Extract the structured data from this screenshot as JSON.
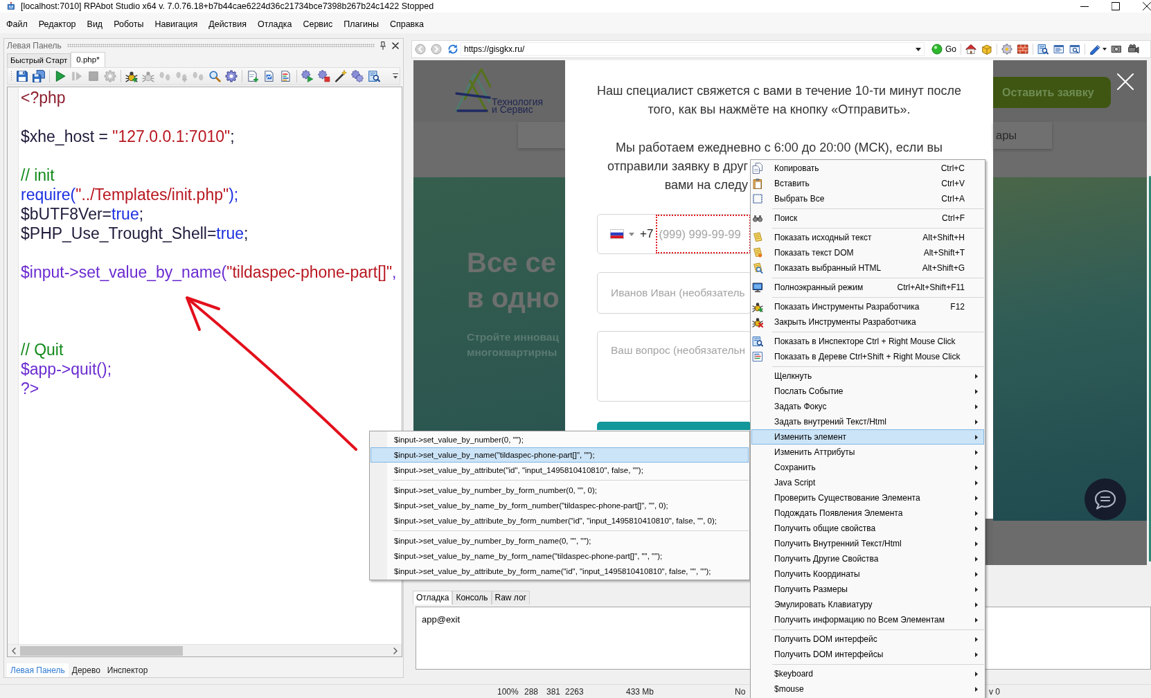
{
  "window": {
    "title": "[localhost:7010] RPAbot Studio x64 v. 7.0.76.18+b7b44cae6224d36c21734bce7398b267b24c1422 Stopped"
  },
  "menu_bar": [
    "Файл",
    "Редактор",
    "Вид",
    "Роботы",
    "Навигация",
    "Действия",
    "Отладка",
    "Сервис",
    "Плагины",
    "Справка"
  ],
  "left_panel": {
    "title": "Левая Панель",
    "tabs": [
      {
        "label": "Быстрый Старт",
        "selected": false
      },
      {
        "label": "0.php*",
        "selected": true
      }
    ],
    "toolbar": [
      [
        {
          "disabled": false
        },
        {
          "disabled": false
        }
      ],
      [
        {
          "disabled": false
        },
        {
          "disabled": true
        },
        {
          "disabled": true
        },
        {
          "disabled": true
        }
      ],
      [
        {
          "disabled": false
        },
        {
          "disabled": true
        },
        {
          "disabled": true
        },
        {
          "disabled": true
        },
        {
          "disabled": true
        },
        {
          "disabled": false
        },
        {
          "disabled": false
        }
      ],
      [
        {
          "disabled": false
        },
        {
          "disabled": false
        },
        {
          "disabled": false
        }
      ],
      [
        {
          "disabled": false
        },
        {
          "disabled": false
        },
        {
          "disabled": false
        },
        {
          "disabled": false
        },
        {
          "disabled": false
        }
      ]
    ],
    "code": [
      {
        "kind": "code",
        "tokens": [
          {
            "kind": "tag_open",
            "text": "<?php"
          }
        ]
      },
      {
        "kind": "blank"
      },
      {
        "kind": "code",
        "tokens": [
          {
            "kind": "var",
            "text": "$xhe_host"
          },
          {
            "kind": "op",
            "text": " = "
          },
          {
            "kind": "string",
            "text": "\"127.0.0.1:7010\""
          },
          {
            "kind": "op",
            "text": ";"
          }
        ]
      },
      {
        "kind": "blank"
      },
      {
        "kind": "code",
        "tokens": [
          {
            "kind": "comment",
            "text": "// init"
          }
        ]
      },
      {
        "kind": "code",
        "tokens": [
          {
            "kind": "func",
            "text": "require("
          },
          {
            "kind": "string",
            "text": "\"../Templates/init.php\""
          },
          {
            "kind": "func",
            "text": ");"
          }
        ]
      },
      {
        "kind": "code",
        "tokens": [
          {
            "kind": "var",
            "text": "$bUTF8Ver"
          },
          {
            "kind": "op",
            "text": "="
          },
          {
            "kind": "keyword",
            "text": "true"
          },
          {
            "kind": "op",
            "text": ";"
          }
        ]
      },
      {
        "kind": "code",
        "tokens": [
          {
            "kind": "var",
            "text": "$PHP_Use_Trought_Shell"
          },
          {
            "kind": "op",
            "text": "="
          },
          {
            "kind": "keyword",
            "text": "true"
          },
          {
            "kind": "op",
            "text": ";"
          }
        ]
      },
      {
        "kind": "blank"
      },
      {
        "kind": "code",
        "tokens": [
          {
            "kind": "call",
            "text": "$input->set_value_by_name("
          },
          {
            "kind": "string",
            "text": "\"tildaspec-phone-part[]\""
          },
          {
            "kind": "call",
            "text": ","
          }
        ]
      },
      {
        "kind": "blank"
      },
      {
        "kind": "blank"
      },
      {
        "kind": "blank"
      },
      {
        "kind": "code",
        "tokens": [
          {
            "kind": "comment",
            "text": "// Quit"
          }
        ]
      },
      {
        "kind": "code",
        "tokens": [
          {
            "kind": "call",
            "text": "$app->quit();"
          }
        ]
      },
      {
        "kind": "code",
        "tokens": [
          {
            "kind": "tag_close",
            "text": "?>"
          }
        ]
      }
    ],
    "bottom_tabs": [
      {
        "label": "Левая Панель",
        "selected": true
      },
      {
        "label": "Дерево",
        "selected": false
      },
      {
        "label": "Инспектор",
        "selected": false
      }
    ]
  },
  "browser": {
    "url": "https://gisgkx.ru/",
    "go_label": "Go",
    "page": {
      "logo_text": [
        "Технология",
        "и Сервис"
      ],
      "nav_link": "ары",
      "hero_title": [
        "Все се",
        "в одно"
      ],
      "hero_subtitle": [
        "Стройте инновац",
        "многоквартирны"
      ],
      "cta_button": "Оставить заявку",
      "modal": {
        "paragraphs": [
          {
            "lines": [
              {
                "text": "Наш специалист свяжется с вами в течение 10-ти минут после",
                "kind": "full"
              },
              {
                "text": "того, как вы нажмёте на кнопку «Отправить».",
                "kind": "full"
              }
            ]
          },
          {
            "lines": [
              {
                "text": "Мы работаем ежедневно с 6:00 до 20:00 (МСК), если вы",
                "kind": "full"
              },
              {
                "text": "отправили заявку в друг",
                "kind": "covered"
              },
              {
                "text": "вами на следу",
                "kind": "covered"
              }
            ]
          }
        ],
        "phone": {
          "code": "+7",
          "placeholder": "(999) 999-99-99",
          "highlighted": true
        },
        "name_field": {
          "placeholder": "Иванов Иван (необязатель"
        },
        "question_field": {
          "placeholder": "Ваш вопрос (необязательн"
        }
      }
    }
  },
  "debug_panel": {
    "tabs": [
      {
        "label": "Отладка",
        "selected": true
      },
      {
        "label": "Консоль",
        "selected": false
      },
      {
        "label": "Raw лог",
        "selected": false
      }
    ],
    "log": "app@exit"
  },
  "status_bar": [
    "100%",
    "288",
    "381",
    "2263",
    "433 Mb",
    "No",
    "v 0"
  ],
  "context_menu": {
    "sections": [
      [
        {
          "label": "Копировать",
          "shortcut": "Ctrl+C",
          "submenu": false,
          "selected": false
        },
        {
          "label": "Вставить",
          "shortcut": "Ctrl+V",
          "submenu": false,
          "selected": false
        },
        {
          "label": "Выбрать Все",
          "shortcut": "Ctrl+A",
          "submenu": false,
          "selected": false
        }
      ],
      [
        {
          "label": "Поиск",
          "shortcut": "Ctrl+F",
          "submenu": false,
          "selected": false
        }
      ],
      [
        {
          "label": "Показать исходный текст",
          "shortcut": "Alt+Shift+H",
          "submenu": false,
          "selected": false
        },
        {
          "label": "Показать текст DOM",
          "shortcut": "Alt+Shift+T",
          "submenu": false,
          "selected": false
        },
        {
          "label": "Показать выбранный HTML",
          "shortcut": "Alt+Shift+G",
          "submenu": false,
          "selected": false
        }
      ],
      [
        {
          "label": "Полноэкранный режим",
          "shortcut": "Ctrl+Alt+Shift+F11",
          "submenu": false,
          "selected": false
        }
      ],
      [
        {
          "label": "Показать Инструменты Разработчика",
          "shortcut": "F12",
          "submenu": false,
          "selected": false
        },
        {
          "label": "Закрыть Инструменты Разработчика",
          "submenu": false,
          "selected": false
        }
      ],
      [
        {
          "label": "Показать в Инспекторе Ctrl + Right Mouse Click",
          "submenu": false,
          "selected": false
        },
        {
          "label": "Показать в Дереве Ctrl+Shift + Right Mouse Click",
          "submenu": false,
          "selected": false
        }
      ],
      [
        {
          "label": "Щелкнуть",
          "submenu": true,
          "selected": false
        },
        {
          "label": "Послать Событие",
          "submenu": true,
          "selected": false
        },
        {
          "label": "Задать Фокус",
          "submenu": true,
          "selected": false
        },
        {
          "label": "Задать внутрений Текст/Html",
          "submenu": true,
          "selected": false
        },
        {
          "label": "Изменить элемент",
          "submenu": true,
          "selected": true
        },
        {
          "label": "Изменить Аттрибуты",
          "submenu": true,
          "selected": false
        },
        {
          "label": "Сохранить",
          "submenu": true,
          "selected": false
        },
        {
          "label": "Java Script",
          "submenu": true,
          "selected": false
        },
        {
          "label": "Проверить Существование Элемента",
          "submenu": true,
          "selected": false
        },
        {
          "label": "Подождать Появления Элемента",
          "submenu": true,
          "selected": false
        },
        {
          "label": "Получить общие свойства",
          "submenu": true,
          "selected": false
        },
        {
          "label": "Получить Внутренний Текст/Html",
          "submenu": true,
          "selected": false
        },
        {
          "label": "Получить Другие Свойства",
          "submenu": true,
          "selected": false
        },
        {
          "label": "Получить Координаты",
          "submenu": true,
          "selected": false
        },
        {
          "label": "Получить Размеры",
          "submenu": true,
          "selected": false
        },
        {
          "label": "Эмулировать Клавиатуру",
          "submenu": true,
          "selected": false
        },
        {
          "label": "Получить информацию по Всем Элементам",
          "submenu": true,
          "selected": false
        }
      ],
      [
        {
          "label": "Получить DOM интерфейс",
          "submenu": true,
          "selected": false
        },
        {
          "label": "Получить DOM интерфейсы",
          "submenu": true,
          "selected": false
        }
      ],
      [
        {
          "label": "$keyboard",
          "submenu": true,
          "selected": false
        },
        {
          "label": "$mouse",
          "submenu": true,
          "selected": false
        }
      ]
    ]
  },
  "submenu": {
    "sections": [
      [
        {
          "label": "$input->set_value_by_number(0, \"\");",
          "selected": false
        },
        {
          "label": "$input->set_value_by_name(\"tildaspec-phone-part[]\", \"\");",
          "selected": true
        },
        {
          "label": "$input->set_value_by_attribute(\"id\", \"input_1495810410810\", false, \"\");",
          "selected": false
        }
      ],
      [
        {
          "label": "$input->set_value_by_number_by_form_number(0, \"\", 0);",
          "selected": false
        },
        {
          "label": "$input->set_value_by_name_by_form_number(\"tildaspec-phone-part[]\", \"\", 0);",
          "selected": false
        },
        {
          "label": "$input->set_value_by_attribute_by_form_number(\"id\", \"input_1495810410810\", false, \"\", 0);",
          "selected": false
        }
      ],
      [
        {
          "label": "$input->set_value_by_number_by_form_name(0, \"\", \"\");",
          "selected": false
        },
        {
          "label": "$input->set_value_by_name_by_form_name(\"tildaspec-phone-part[]\", \"\", \"\");",
          "selected": false
        },
        {
          "label": "$input->set_value_by_attribute_by_form_name(\"id\", \"input_1495810410810\", false, \"\", \"\");",
          "selected": false
        }
      ]
    ]
  }
}
